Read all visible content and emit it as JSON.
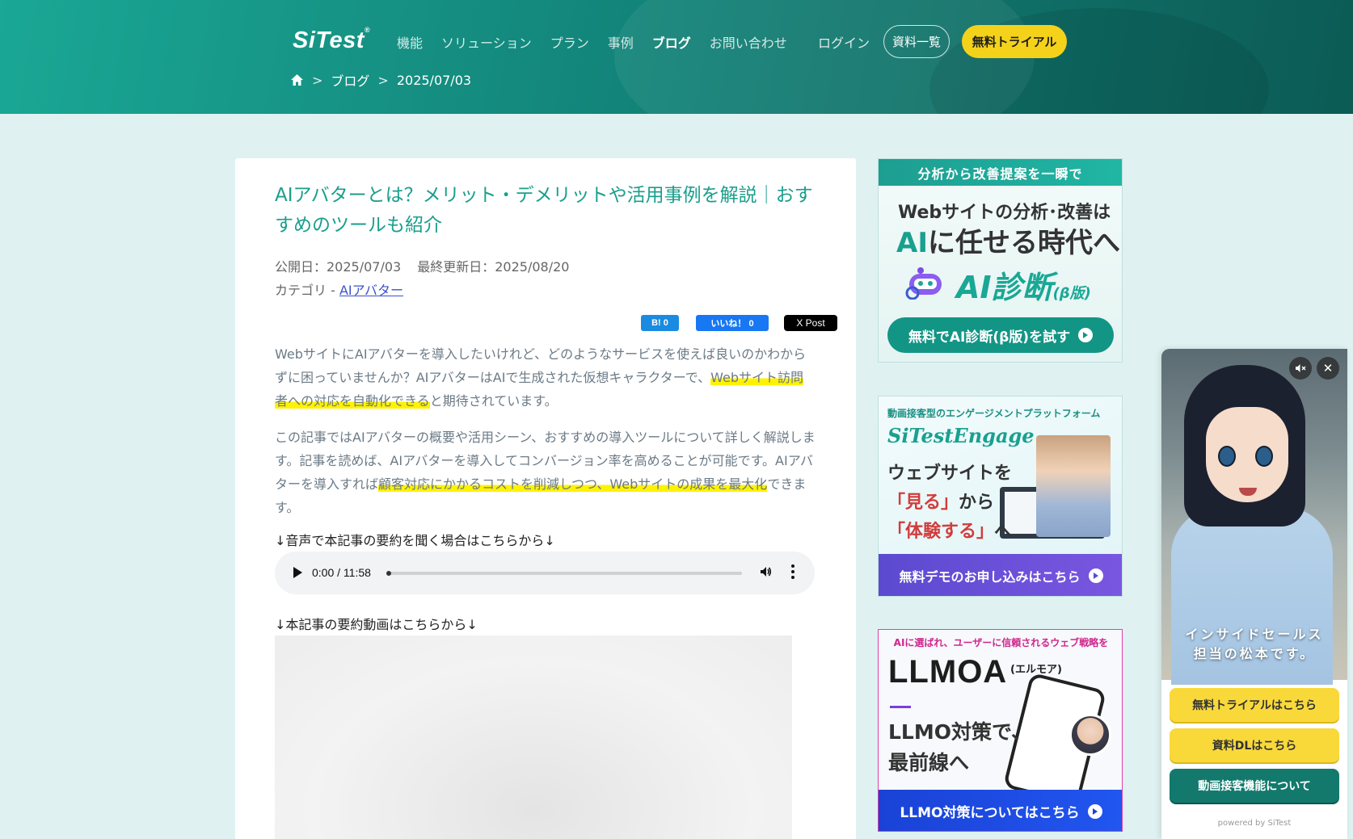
{
  "header": {
    "logo": "SiTest",
    "logo_mark": "®",
    "nav": [
      {
        "label": "機能"
      },
      {
        "label": "ソリューション"
      },
      {
        "label": "プラン"
      },
      {
        "label": "事例"
      },
      {
        "label": "ブログ",
        "active": true
      },
      {
        "label": "お問い合わせ"
      }
    ],
    "login": "ログイン",
    "docs_button": "資料一覧",
    "trial_button": "無料トライアル"
  },
  "breadcrumb": {
    "sep": ">",
    "items": [
      "ブログ",
      "2025/07/03"
    ]
  },
  "article": {
    "title": "AIアバターとは？メリット・デメリットや活用事例を解説｜おすすめのツールも紹介",
    "published": "公開日：2025/07/03",
    "updated": "最終更新日：2025/08/20",
    "category_prefix": "カテゴリ - ",
    "category": "AIアバター",
    "share": {
      "hatena": "B! 0",
      "facebook": "いいね！ 0",
      "x": "X Post"
    },
    "p1_a": "WebサイトにAIアバターを導入したいけれど、どのようなサービスを使えば良いのかわからずに困っていませんか？AIアバターはAIで生成された仮想キャラクターで、",
    "p1_mark": "Webサイト訪問者への対応を自動化できる",
    "p1_b": "と期待されています。",
    "p2_a": "この記事ではAIアバターの概要や活用シーン、おすすめの導入ツールについて詳しく解説します。記事を読めば、AIアバターを導入してコンバージョン率を高めることが可能です。AIアバターを導入すれば",
    "p2_mark": "顧客対応にかかるコストを削減しつつ、Webサイトの成果を最大化",
    "p2_b": "できます。",
    "audio_label": "↓音声で本記事の要約を聞く場合はこちらから↓",
    "audio_time": "0:00 / 11:58",
    "video_label": "↓本記事の要約動画はこちらから↓"
  },
  "sidebar": {
    "banner1": {
      "top": "分析から改善提案を一瞬で",
      "line1": "Webサイトの分析･改善は",
      "line2_em": "AI",
      "line2": "に任せる時代へ",
      "line3": "AI診断",
      "line3_small": "(β版)",
      "cta": "無料でAI診断(β版)を試す"
    },
    "banner2": {
      "small": "動画接客型のエンゲージメントプラットフォーム",
      "brand": "SiTest",
      "brand_b": "Engage",
      "line1": "ウェブサイトを",
      "line2_em": "「見る」",
      "line2": "から",
      "line3_em": "「体験する」",
      "line3": "へ",
      "cta": "無料デモのお申し込みはこちら"
    },
    "banner3": {
      "small": "AIに選ばれ、ユーザーに信頼されるウェブ戦略を",
      "brand": "LLMOA",
      "brand_sub": "(エルモア)",
      "line1": "LLMO対策で、",
      "line2": "最前線へ",
      "cta": "LLMO対策についてはこちら"
    }
  },
  "widget": {
    "caption1": "インサイドセールス",
    "caption2": "担当の松本です。",
    "btn1": "無料トライアルはこちら",
    "btn2": "資料DLはこちら",
    "btn3": "動画接客機能について",
    "powered": "powered by SiTest"
  }
}
